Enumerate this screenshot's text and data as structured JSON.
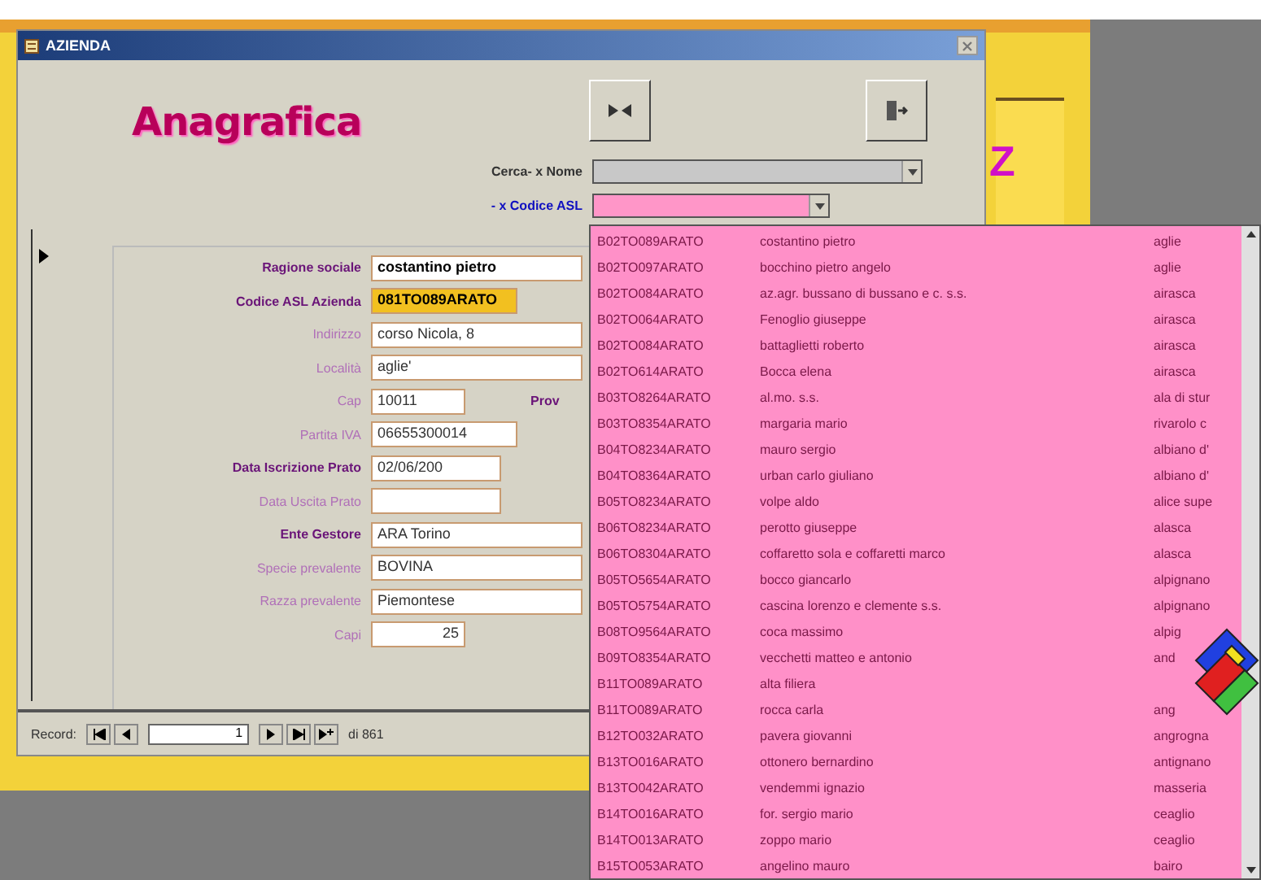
{
  "window": {
    "title": "AZIENDA"
  },
  "header": {
    "title": "Anagrafica"
  },
  "search": [
    {
      "label": "Cerca- x Nome",
      "kind": "name"
    },
    {
      "label": "- x Codice ASL",
      "kind": "code"
    }
  ],
  "fields": [
    {
      "label": "Ragione sociale",
      "value": "costantino pietro",
      "kind": "long",
      "label_bold": true,
      "value_bold": true,
      "highlighted": false
    },
    {
      "label": "Codice ASL Azienda",
      "value": "081TO089ARATO",
      "kind": "medium",
      "label_bold": true,
      "value_bold": true,
      "highlighted": true
    },
    {
      "label": "Indirizzo",
      "value": "corso Nicola, 8",
      "kind": "long",
      "label_bold": false,
      "value_bold": false,
      "highlighted": false
    },
    {
      "label": "Località",
      "value": "aglie'",
      "kind": "long",
      "label_bold": false,
      "value_bold": false,
      "highlighted": false
    },
    {
      "label": "Cap",
      "value": "10011",
      "kind": "short",
      "label_bold": false,
      "value_bold": false,
      "highlighted": false,
      "side_label": "Prov"
    },
    {
      "label": "Partita IVA",
      "value": "06655300014",
      "kind": "medium",
      "label_bold": false,
      "value_bold": false,
      "highlighted": false
    },
    {
      "label": "Data Iscrizione Prato",
      "value": "02/06/200",
      "kind": "date",
      "label_bold": true,
      "value_bold": false,
      "highlighted": false
    },
    {
      "label": "Data Uscita Prato",
      "kind": "date",
      "label_bold": false,
      "highlighted": false
    },
    {
      "label": "Ente Gestore",
      "value": "ARA Torino",
      "kind": "long",
      "label_bold": true,
      "value_bold": false,
      "highlighted": false
    },
    {
      "label": "Specie prevalente",
      "value": "BOVINA",
      "kind": "long",
      "label_bold": false,
      "value_bold": false,
      "highlighted": false
    },
    {
      "label": "Razza prevalente",
      "value": "Piemontese",
      "kind": "long",
      "label_bold": false,
      "value_bold": false,
      "highlighted": false
    },
    {
      "label": "Capi",
      "value": "25",
      "kind": "number",
      "label_bold": false,
      "value_bold": false,
      "highlighted": false
    }
  ],
  "navigation": {
    "label": "Record:",
    "current": "1",
    "total": "di 861"
  },
  "dropdown": {
    "rows": [
      {
        "code": "B02TO089ARATO",
        "name": "costantino pietro",
        "town": "aglie"
      },
      {
        "code": "B02TO097ARATO",
        "name": "bocchino pietro angelo",
        "town": "aglie"
      },
      {
        "code": "B02TO084ARATO",
        "name": "az.agr. bussano di bussano e c. s.s.",
        "town": "airasca"
      },
      {
        "code": "B02TO064ARATO",
        "name": "Fenoglio giuseppe",
        "town": "airasca"
      },
      {
        "code": "B02TO084ARATO",
        "name": "battaglietti roberto",
        "town": "airasca"
      },
      {
        "code": "B02TO614ARATO",
        "name": "Bocca elena",
        "town": "airasca"
      },
      {
        "code": "B03TO8264ARATO",
        "name": "al.mo. s.s.",
        "town": "ala di stur"
      },
      {
        "code": "B03TO8354ARATO",
        "name": "margaria mario",
        "town": "rivarolo c"
      },
      {
        "code": "B04TO8234ARATO",
        "name": "mauro sergio",
        "town": "albiano d'"
      },
      {
        "code": "B04TO8364ARATO",
        "name": "urban carlo giuliano",
        "town": "albiano d'"
      },
      {
        "code": "B05TO8234ARATO",
        "name": "volpe aldo",
        "town": "alice supe"
      },
      {
        "code": "B06TO8234ARATO",
        "name": "perotto giuseppe",
        "town": "alasca"
      },
      {
        "code": "B06TO8304ARATO",
        "name": "coffaretto sola e coffaretti marco",
        "town": "alasca"
      },
      {
        "code": "B05TO5654ARATO",
        "name": "bocco giancarlo",
        "town": "alpignano"
      },
      {
        "code": "B05TO5754ARATO",
        "name": "cascina lorenzo e clemente s.s.",
        "town": "alpignano"
      },
      {
        "code": "B08TO9564ARATO",
        "name": "coca massimo",
        "town": "alpig"
      },
      {
        "code": "B09TO8354ARATO",
        "name": "vecchetti matteo e antonio",
        "town": "and"
      },
      {
        "code": "B11TO089ARATO",
        "name": "alta filiera"
      },
      {
        "code": "B11TO089ARATO",
        "name": "rocca carla",
        "town": "ang"
      },
      {
        "code": "B12TO032ARATO",
        "name": "pavera giovanni",
        "town": "angrogna"
      },
      {
        "code": "B13TO016ARATO",
        "name": "ottonero bernardino",
        "town": "antignano"
      },
      {
        "code": "B13TO042ARATO",
        "name": "vendemmi ignazio",
        "town": "masseria"
      },
      {
        "code": "B14TO016ARATO",
        "name": "for. sergio mario",
        "town": "ceaglio"
      },
      {
        "code": "B14TO013ARATO",
        "name": "zoppo mario",
        "town": "ceaglio"
      },
      {
        "code": "B15TO053ARATO",
        "name": "angelino mauro",
        "town": "bairo"
      }
    ]
  },
  "background": {
    "letter": "Z"
  }
}
